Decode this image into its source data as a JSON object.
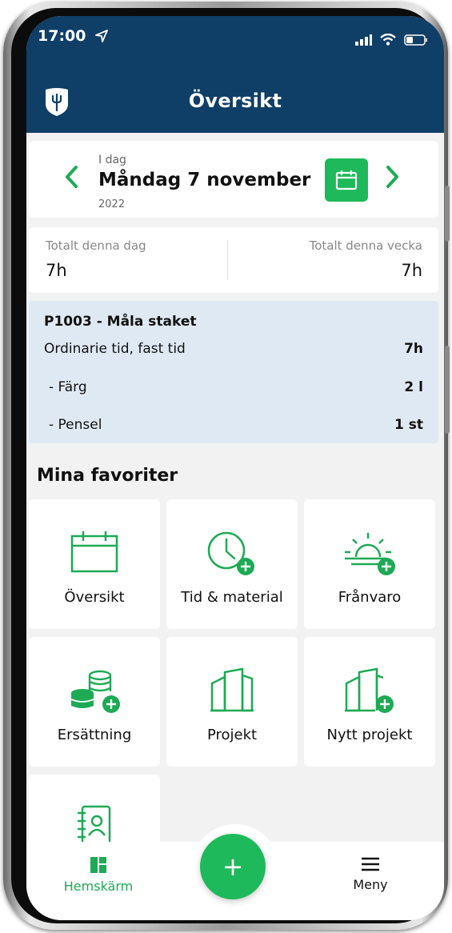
{
  "status": {
    "time": "17:00"
  },
  "header": {
    "title": "Översikt"
  },
  "date": {
    "small": "I dag",
    "main": "Måndag 7 november",
    "year": "2022"
  },
  "totals": {
    "day_label": "Totalt denna dag",
    "day_value": "7h",
    "week_label": "Totalt denna vecka",
    "week_value": "7h"
  },
  "entry": {
    "title": "P1003 - Måla staket",
    "rows": [
      {
        "label": "Ordinarie tid, fast tid",
        "value": "7h"
      },
      {
        "label": "- Färg",
        "value": "2 l"
      },
      {
        "label": "- Pensel",
        "value": "1 st"
      }
    ]
  },
  "favorites": {
    "title": "Mina favoriter",
    "tiles": [
      {
        "label": "Översikt",
        "icon": "calendar-icon"
      },
      {
        "label": "Tid & material",
        "icon": "clock-plus-icon"
      },
      {
        "label": "Frånvaro",
        "icon": "sunrise-plus-icon"
      },
      {
        "label": "Ersättning",
        "icon": "coins-plus-icon"
      },
      {
        "label": "Projekt",
        "icon": "building-icon"
      },
      {
        "label": "Nytt projekt",
        "icon": "building-plus-icon"
      },
      {
        "label": "",
        "icon": "contact-book-icon"
      }
    ]
  },
  "nav": {
    "home": "Hemskärm",
    "menu": "Meny",
    "fab": "+"
  },
  "colors": {
    "header": "#0f3e66",
    "accent": "#1eb95a",
    "entry_bg": "#dfe9f4"
  }
}
